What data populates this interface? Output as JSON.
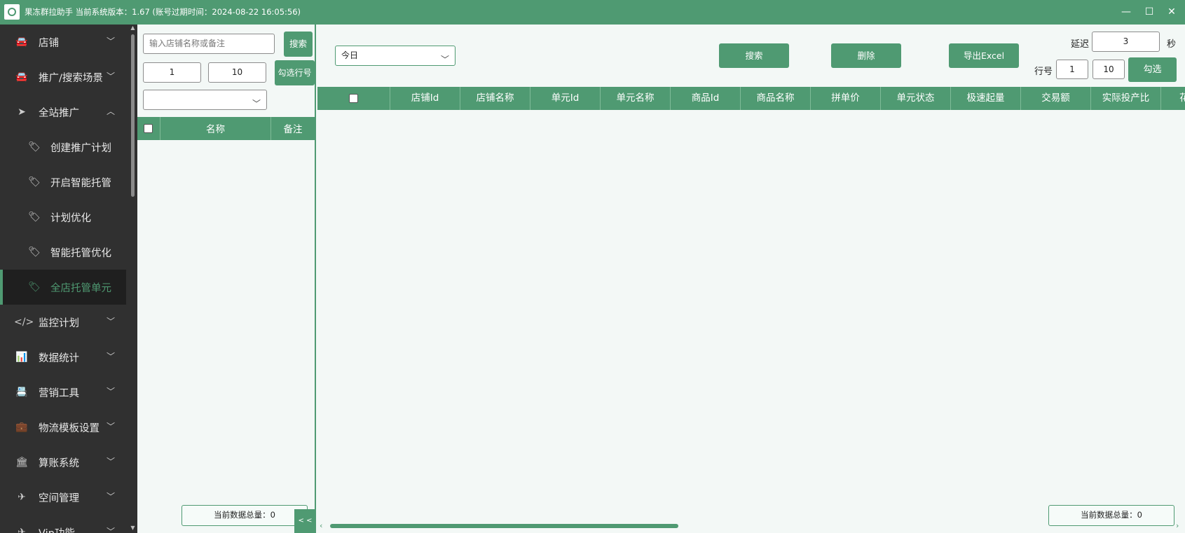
{
  "titlebar": {
    "title": "果冻群拉助手 当前系统版本：1.67 (账号过期时间：2024-08-22 16:05:56)",
    "minimize_icon": "—",
    "maximize_icon": "☐",
    "close_icon": "✕"
  },
  "sidebar": {
    "items": [
      {
        "label": "店铺",
        "icon": "car-icon"
      },
      {
        "label": "推广/搜索场景",
        "icon": "car-icon"
      },
      {
        "label": "全站推广",
        "icon": "navigation-arrow-icon"
      },
      {
        "label": "创建推广计划",
        "icon": "tag-icon"
      },
      {
        "label": "开启智能托管",
        "icon": "tag-icon"
      },
      {
        "label": "计划优化",
        "icon": "tag-icon"
      },
      {
        "label": "智能托管优化",
        "icon": "tag-icon"
      },
      {
        "label": "全店托管单元",
        "icon": "tag-icon",
        "active": true
      },
      {
        "label": "监控计划",
        "icon": "code-icon"
      },
      {
        "label": "数据统计",
        "icon": "bar-chart-icon"
      },
      {
        "label": "营销工具",
        "icon": "contact-book-icon"
      },
      {
        "label": "物流模板设置",
        "icon": "briefcase-icon"
      },
      {
        "label": "算账系统",
        "icon": "bank-icon"
      },
      {
        "label": "空间管理",
        "icon": "plane-icon"
      },
      {
        "label": "Vip功能",
        "icon": "plane-icon"
      }
    ]
  },
  "left_panel": {
    "search_placeholder": "输入店铺名称或备注",
    "search_button": "搜索",
    "row_from": "1",
    "row_to": "10",
    "check_rows_button": "勾选行号",
    "dropdown_value": "",
    "grid_headers": [
      "名称",
      "备注"
    ],
    "total_label": "当前数据总量：",
    "total_value": "0",
    "collapse_button": "< <"
  },
  "main": {
    "date_select": "今日",
    "search_button": "搜索",
    "delete_button": "删除",
    "export_button": "导出Excel",
    "delay_label": "延迟",
    "delay_value": "3",
    "delay_unit": "秒",
    "row_label": "行号",
    "row_from": "1",
    "row_to": "10",
    "check_button": "勾选",
    "grid_headers": [
      "店铺Id",
      "店铺名称",
      "单元Id",
      "单元名称",
      "商品Id",
      "商品名称",
      "拼单价",
      "单元状态",
      "极速起量",
      "交易额",
      "实际投产比",
      "花"
    ],
    "total_label": "当前数据总量：",
    "total_value": "0"
  },
  "colors": {
    "accent": "#4f9a72",
    "sidebar_bg": "#303030",
    "panel_bg": "#f3f8f6"
  }
}
